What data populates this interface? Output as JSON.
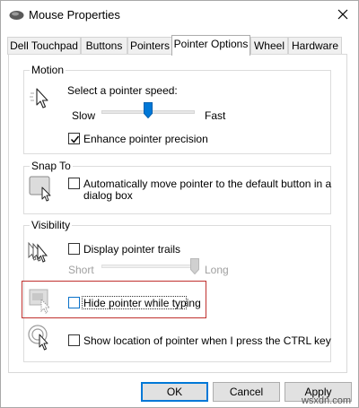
{
  "window": {
    "title": "Mouse Properties"
  },
  "tabs": [
    {
      "label": "Dell Touchpad"
    },
    {
      "label": "Buttons"
    },
    {
      "label": "Pointers"
    },
    {
      "label": "Pointer Options"
    },
    {
      "label": "Wheel"
    },
    {
      "label": "Hardware"
    }
  ],
  "active_tab": "Pointer Options",
  "motion": {
    "group_label": "Motion",
    "speed_label": "Select a pointer speed:",
    "slow_label": "Slow",
    "fast_label": "Fast",
    "speed_level": 0.5,
    "precision_label": "Enhance pointer precision",
    "precision_checked": true
  },
  "snap_to": {
    "group_label": "Snap To",
    "snap_label_line1": "Automatically move pointer to the default button in a",
    "snap_label_line2": "dialog box",
    "snap_checked": false
  },
  "visibility": {
    "group_label": "Visibility",
    "trails_label": "Display pointer trails",
    "trails_checked": false,
    "short_label": "Short",
    "long_label": "Long",
    "trail_length_level": 1.0,
    "hide_label": "Hide pointer while typing",
    "hide_checked": false,
    "show_location_label": "Show location of pointer when I press the CTRL key",
    "show_location_checked": false
  },
  "buttons": {
    "ok": "OK",
    "cancel": "Cancel",
    "apply": "Apply"
  },
  "watermark": "wsxdn.com",
  "colors": {
    "accent": "#0078d7",
    "highlight": "#c0302e"
  }
}
